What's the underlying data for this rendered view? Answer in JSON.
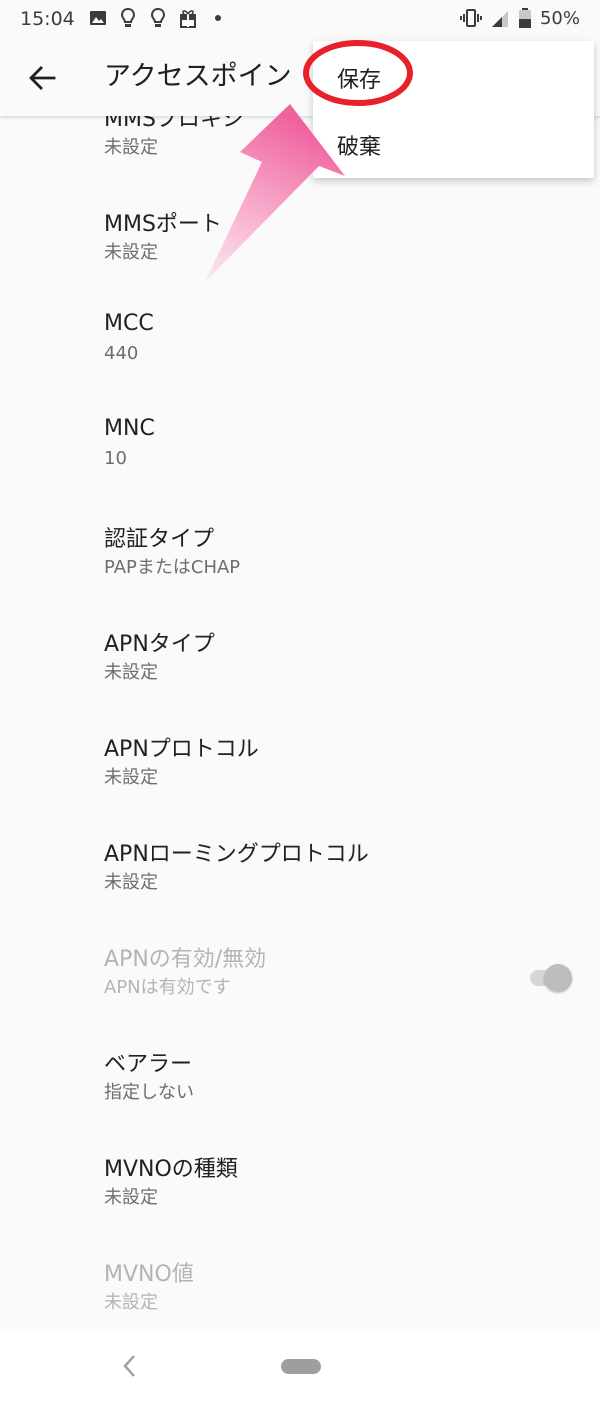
{
  "status_bar": {
    "time": "15:04",
    "battery": "50%",
    "icons_left": [
      "image-icon",
      "lightbulb-icon",
      "lightbulb-icon",
      "gift-icon",
      "dot-icon"
    ],
    "icons_right": [
      "vibrate-icon",
      "signal-icon",
      "battery-icon"
    ]
  },
  "app_bar": {
    "title": "アクセスポイン"
  },
  "menu": {
    "save_label": "保存",
    "discard_label": "破棄"
  },
  "items": [
    {
      "title": "MMSプロキシ",
      "summary": "未設定",
      "disabled": false
    },
    {
      "title": "MMSポート",
      "summary": "未設定",
      "disabled": false
    },
    {
      "title": "MCC",
      "summary": "440",
      "disabled": false
    },
    {
      "title": "MNC",
      "summary": "10",
      "disabled": false
    },
    {
      "title": "認証タイプ",
      "summary": "PAPまたはCHAP",
      "disabled": false
    },
    {
      "title": "APNタイプ",
      "summary": "未設定",
      "disabled": false
    },
    {
      "title": "APNプロトコル",
      "summary": "未設定",
      "disabled": false
    },
    {
      "title": "APNローミングプロトコル",
      "summary": "未設定",
      "disabled": false
    },
    {
      "title": "APNの有効/無効",
      "summary": "APNは有効です",
      "disabled": true,
      "toggle_on": true
    },
    {
      "title": "ベアラー",
      "summary": "指定しない",
      "disabled": false
    },
    {
      "title": "MVNOの種類",
      "summary": "未設定",
      "disabled": false
    },
    {
      "title": "MVNO値",
      "summary": "未設定",
      "disabled": true
    }
  ],
  "colors": {
    "annotation_circle": "#e8202a",
    "annotation_arrow": "#f05a9a",
    "disabled_text": "#b4b4b4"
  }
}
